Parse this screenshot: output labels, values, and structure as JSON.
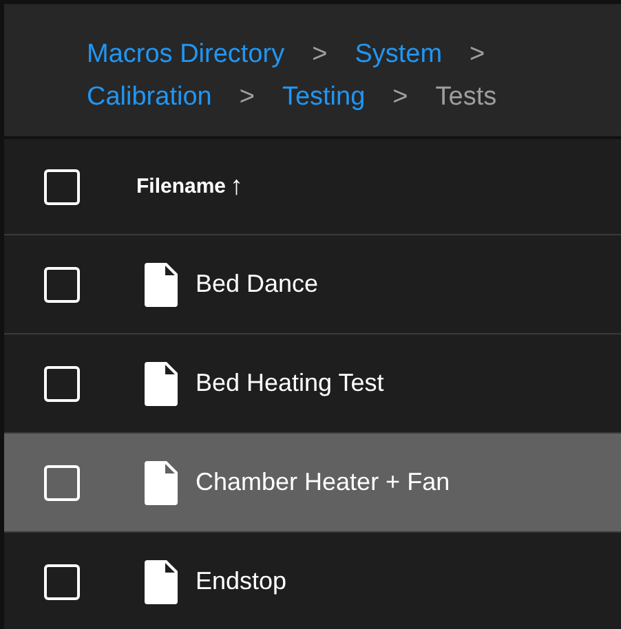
{
  "breadcrumbs": [
    {
      "kind": "link",
      "text": "Macros Directory"
    },
    {
      "kind": "separator",
      "text": ">"
    },
    {
      "kind": "link",
      "text": "System"
    },
    {
      "kind": "separator",
      "text": ">"
    },
    {
      "kind": "link",
      "text": "Calibration"
    },
    {
      "kind": "separator",
      "text": ">"
    },
    {
      "kind": "link",
      "text": "Testing"
    },
    {
      "kind": "separator",
      "text": ">"
    },
    {
      "kind": "current",
      "text": "Tests"
    }
  ],
  "table": {
    "header": {
      "checked": false,
      "label": "Filename",
      "sort_icon": "↑"
    },
    "rows": [
      {
        "name": "Bed Dance",
        "checked": false,
        "highlighted": false
      },
      {
        "name": "Bed Heating Test",
        "checked": false,
        "highlighted": false
      },
      {
        "name": "Chamber Heater + Fan",
        "checked": false,
        "highlighted": true
      },
      {
        "name": "Endstop",
        "checked": false,
        "highlighted": false
      }
    ]
  }
}
